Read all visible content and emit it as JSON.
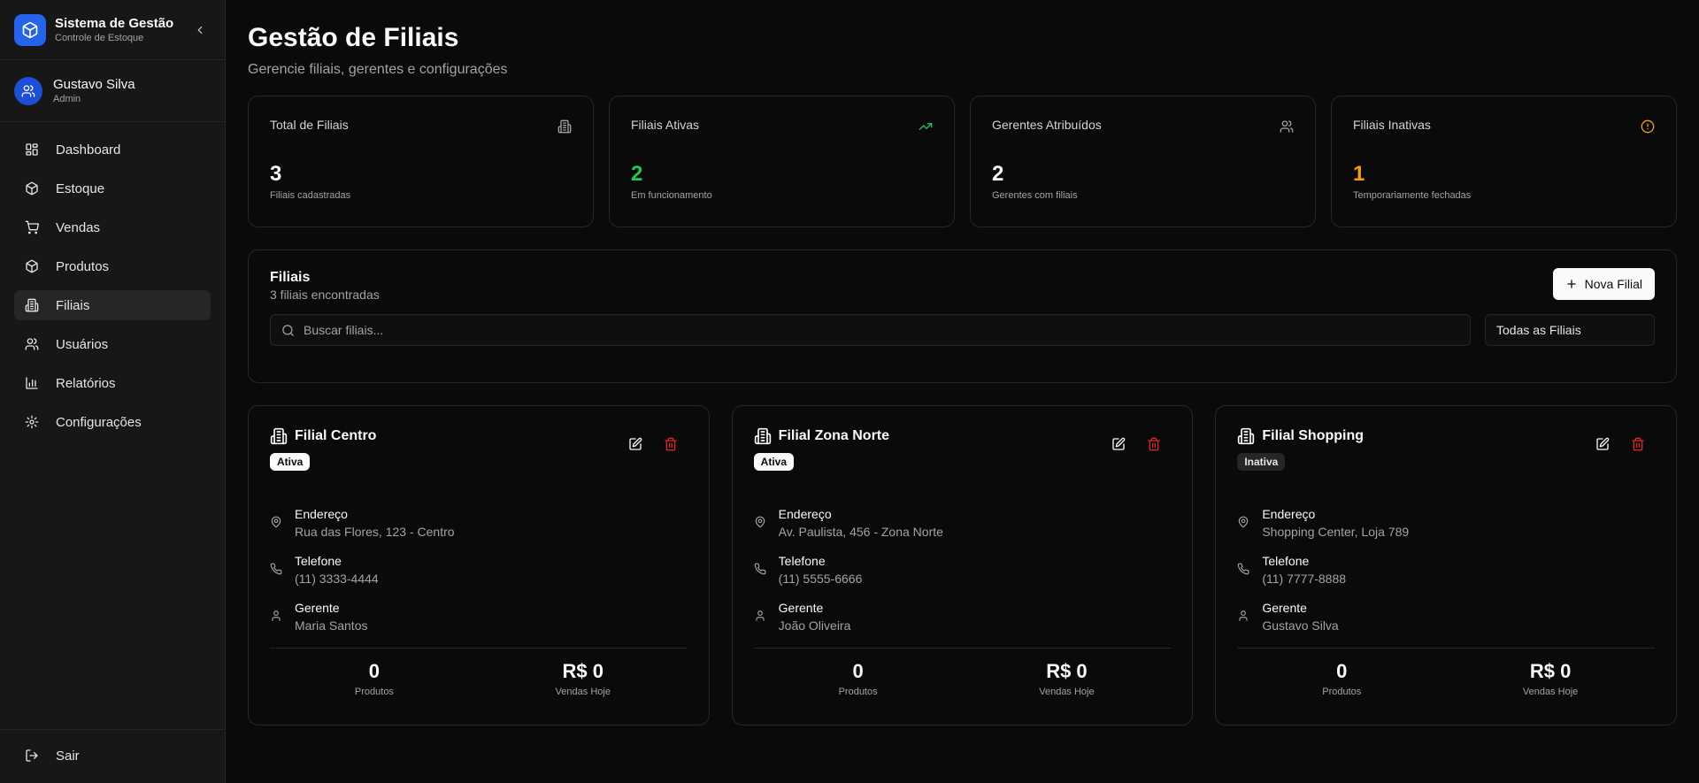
{
  "brand": {
    "title": "Sistema de Gestão",
    "subtitle": "Controle de Estoque",
    "icon": "cube-icon"
  },
  "user": {
    "name": "Gustavo Silva",
    "role": "Admin"
  },
  "nav": [
    {
      "label": "Dashboard",
      "icon": "dashboard-icon"
    },
    {
      "label": "Estoque",
      "icon": "box-icon"
    },
    {
      "label": "Vendas",
      "icon": "cart-icon"
    },
    {
      "label": "Produtos",
      "icon": "package-icon"
    },
    {
      "label": "Filiais",
      "icon": "building-icon",
      "active": true
    },
    {
      "label": "Usuários",
      "icon": "users-icon"
    },
    {
      "label": "Relatórios",
      "icon": "bar-chart-icon"
    },
    {
      "label": "Configurações",
      "icon": "gear-icon"
    }
  ],
  "logout_label": "Sair",
  "page": {
    "title": "Gestão de Filiais",
    "subtitle": "Gerencie filiais, gerentes e configurações"
  },
  "stats": [
    {
      "label": "Total de Filiais",
      "value": "3",
      "desc": "Filiais cadastradas",
      "icon": "building-icon"
    },
    {
      "label": "Filiais Ativas",
      "value": "2",
      "desc": "Em funcionamento",
      "icon": "trending-up-icon",
      "color": "#22c55e"
    },
    {
      "label": "Gerentes Atribuídos",
      "value": "2",
      "desc": "Gerentes com filiais",
      "icon": "users-icon"
    },
    {
      "label": "Filiais Inativas",
      "value": "1",
      "desc": "Temporariamente fechadas",
      "icon": "alert-circle-icon",
      "color": "#f59e0b"
    }
  ],
  "list": {
    "title": "Filiais",
    "count_text": "3 filiais encontradas",
    "new_button": "Nova Filial",
    "search_placeholder": "Buscar filiais...",
    "filter_value": "Todas as Filiais"
  },
  "labels": {
    "address": "Endereço",
    "phone": "Telefone",
    "manager": "Gerente",
    "products": "Produtos",
    "sales_today": "Vendas Hoje"
  },
  "branches": [
    {
      "name": "Filial Centro",
      "status": "Ativa",
      "address": "Rua das Flores, 123 - Centro",
      "phone": "(11) 3333-4444",
      "manager": "Maria Santos",
      "products": "0",
      "sales": "R$ 0"
    },
    {
      "name": "Filial Zona Norte",
      "status": "Ativa",
      "address": "Av. Paulista, 456 - Zona Norte",
      "phone": "(11) 5555-6666",
      "manager": "João Oliveira",
      "products": "0",
      "sales": "R$ 0"
    },
    {
      "name": "Filial Shopping",
      "status": "Inativa",
      "address": "Shopping Center, Loja 789",
      "phone": "(11) 7777-8888",
      "manager": "Gustavo Silva",
      "products": "0",
      "sales": "R$ 0"
    }
  ],
  "colors": {
    "accent": "#2563eb",
    "danger": "#dc2626",
    "success": "#22c55e",
    "warning": "#f59e0b"
  }
}
